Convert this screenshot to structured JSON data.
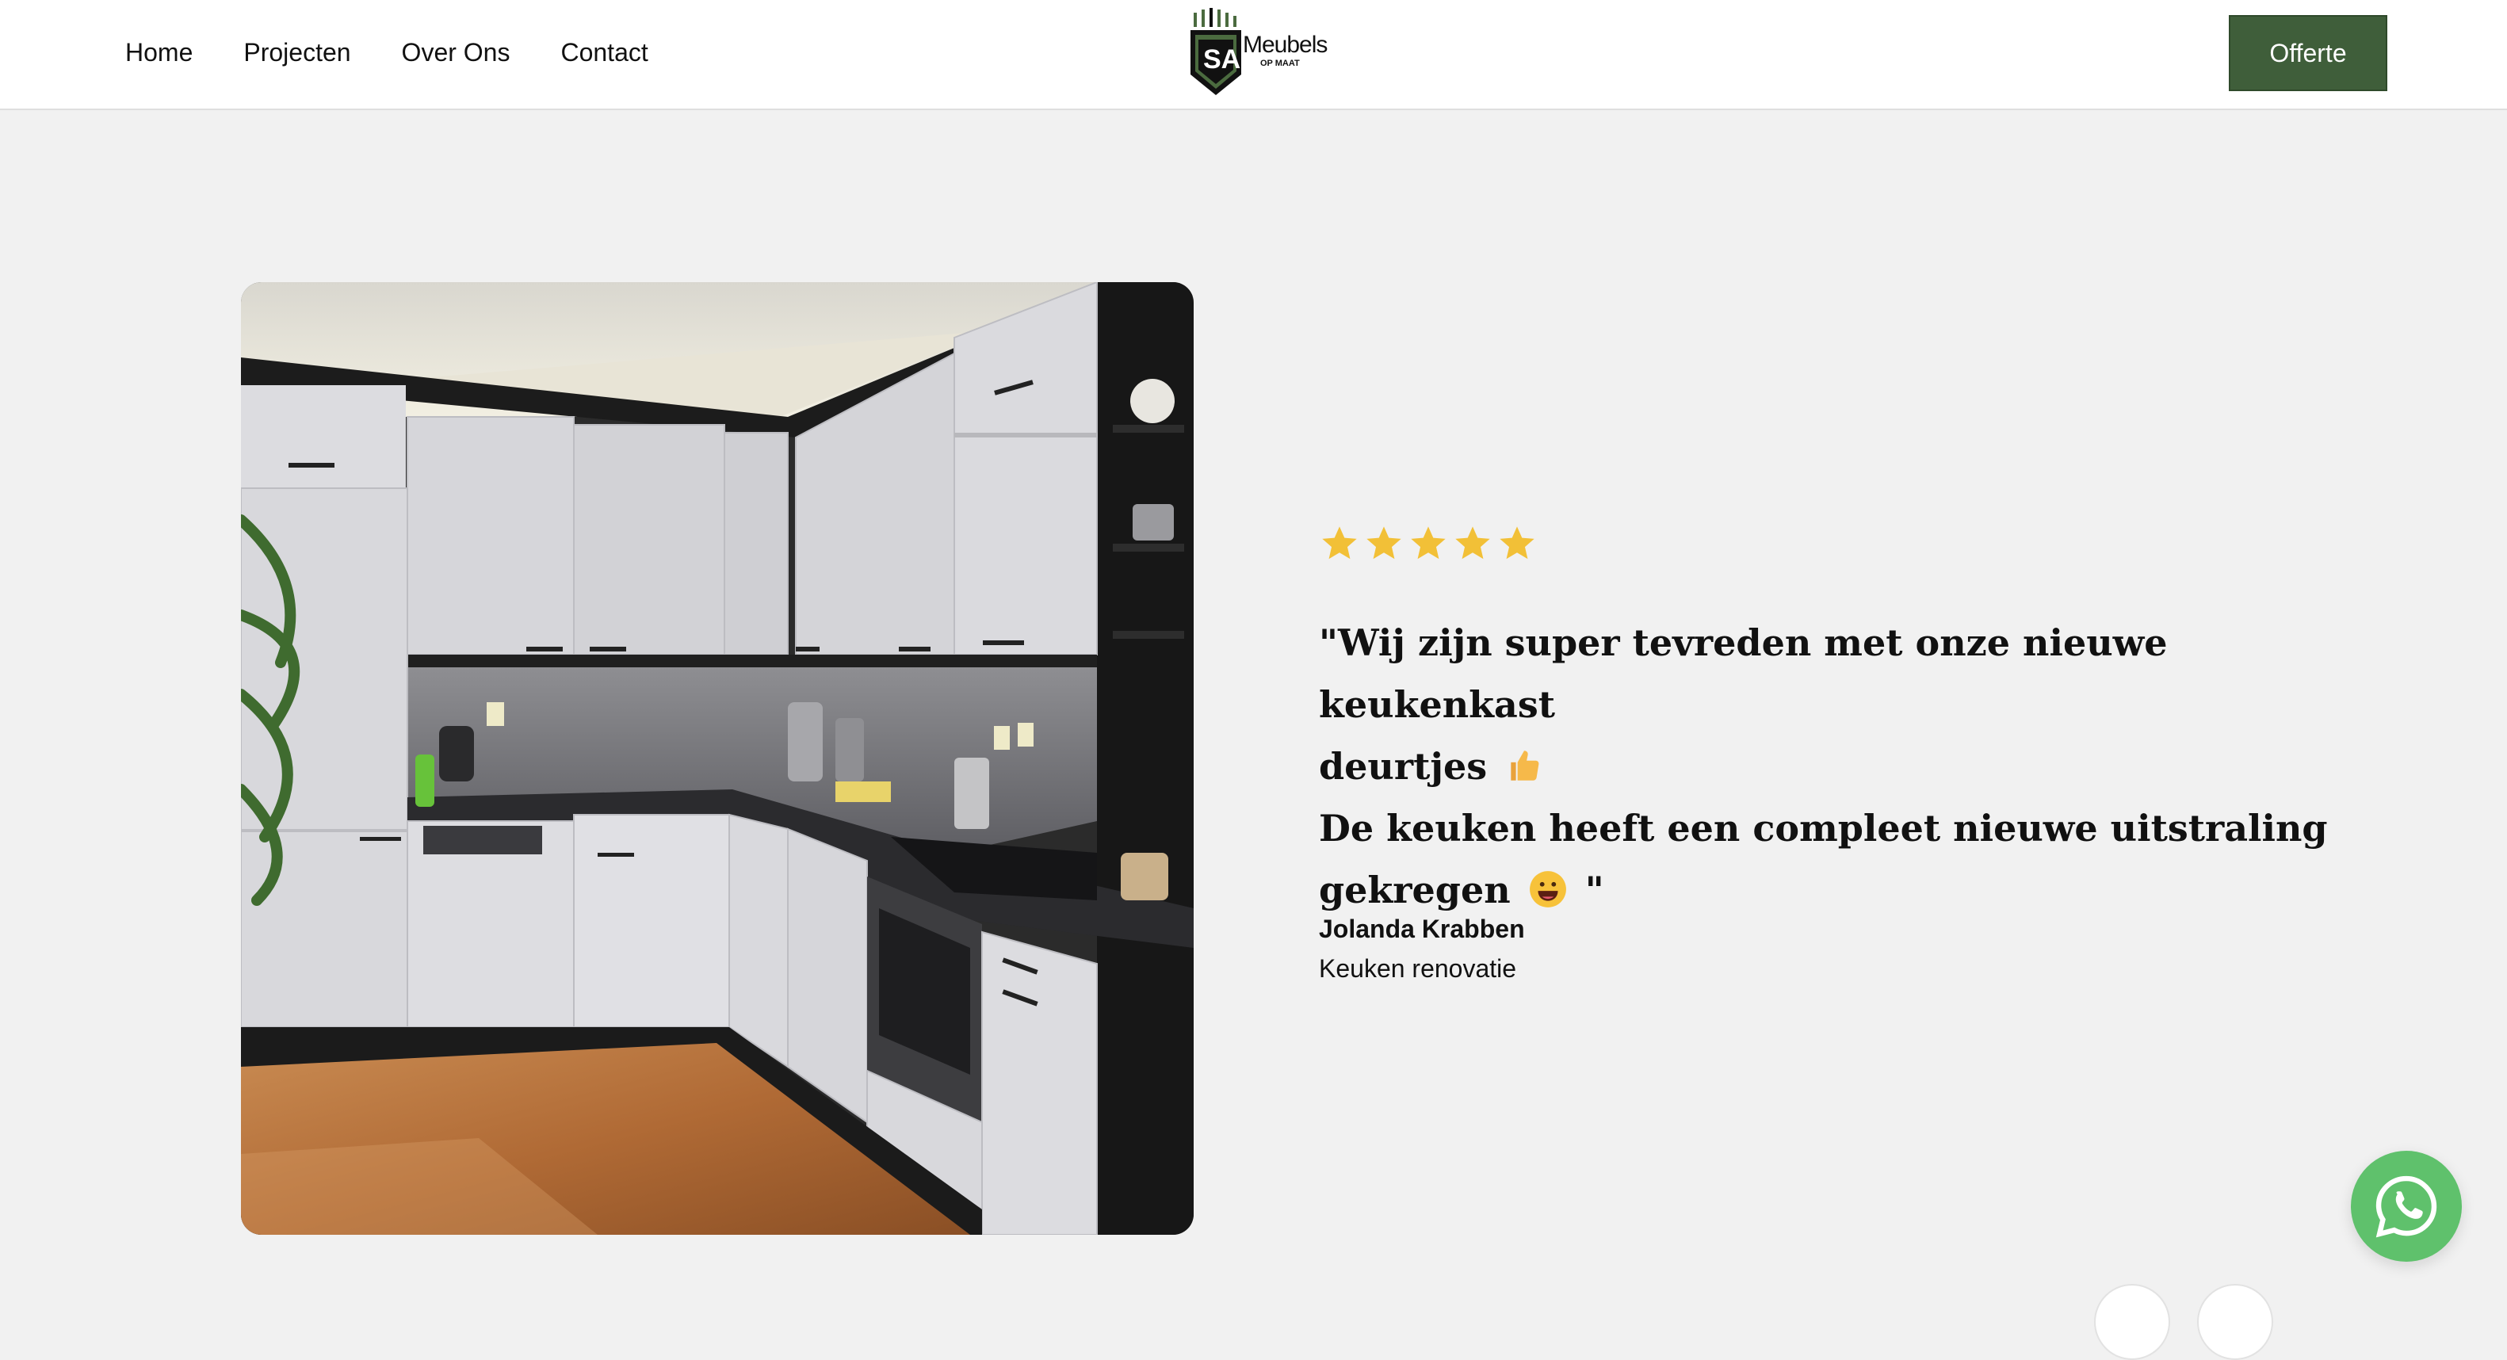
{
  "header": {
    "nav": [
      "Home",
      "Projecten",
      "Over Ons",
      "Contact"
    ],
    "logo": {
      "brand": "Meubels",
      "sub": "OP MAAT"
    },
    "cta_label": "Offerte",
    "accent_color": "#3f5e3a"
  },
  "testimonial": {
    "rating": 5,
    "quote_line1": "\"Wij zijn super tevreden met onze nieuwe keukenkast",
    "quote_line2": "deurtjes",
    "quote_line3": "De keuken heeft een compleet nieuwe uitstraling",
    "quote_line4": "gekregen",
    "quote_end": "\"",
    "author": "Jolanda Krabben",
    "service": "Keuken renovatie",
    "star_color": "#f2c037"
  },
  "widgets": {
    "whatsapp_color": "#5fc16c"
  }
}
